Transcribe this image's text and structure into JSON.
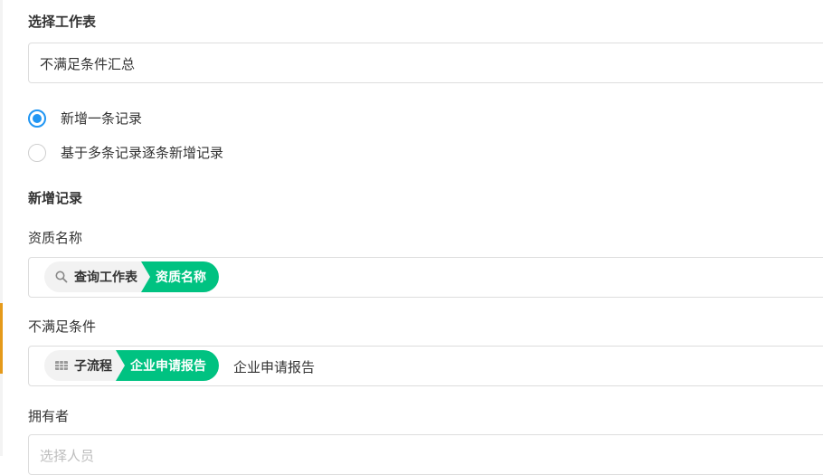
{
  "section_select_sheet": {
    "title": "选择工作表",
    "value": "不满足条件汇总"
  },
  "radio_options": [
    {
      "label": "新增一条记录",
      "checked": true
    },
    {
      "label": "基于多条记录逐条新增记录",
      "checked": false
    }
  ],
  "section_new_record": {
    "title": "新增记录"
  },
  "fields": {
    "qualification_name": {
      "label": "资质名称",
      "tag_source": "查询工作表",
      "tag_field": "资质名称",
      "source_icon": "search-icon"
    },
    "unmet_condition": {
      "label": "不满足条件",
      "tag_source": "子流程",
      "tag_field": "企业申请报告",
      "trailing_text": "企业申请报告",
      "source_icon": "table-icon"
    },
    "owner": {
      "label": "拥有者",
      "placeholder": "选择人员"
    }
  },
  "colors": {
    "accent_green": "#00c281",
    "radio_blue": "#2196f3",
    "left_accent": "#e59a1a"
  }
}
